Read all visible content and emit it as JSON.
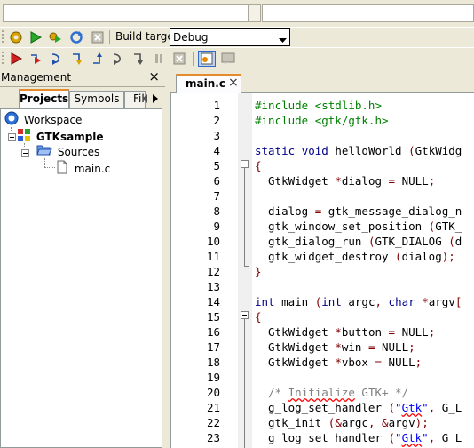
{
  "toolbar": {
    "build_target_label": "Build target:",
    "build_target_value": "Debug"
  },
  "management": {
    "title": "Management",
    "close_glyph": "×",
    "tabs": [
      "Projects",
      "Symbols",
      "File"
    ],
    "tree": {
      "workspace": "Workspace",
      "project": "GTKsample",
      "folder": "Sources",
      "file": "main.c"
    }
  },
  "editor": {
    "tab_label": "main.c",
    "tab_close": "×",
    "line_numbers": [
      "1",
      "2",
      "3",
      "4",
      "5",
      "6",
      "7",
      "8",
      "9",
      "10",
      "11",
      "12",
      "13",
      "14",
      "15",
      "16",
      "17",
      "18",
      "19",
      "20",
      "21",
      "22",
      "23"
    ]
  },
  "colors": {
    "keyword": "#00008b",
    "preprocessor": "#008000",
    "string": "#0000ff",
    "comment": "#808080",
    "operator": "#800000",
    "selection_border": "#316ac5"
  }
}
